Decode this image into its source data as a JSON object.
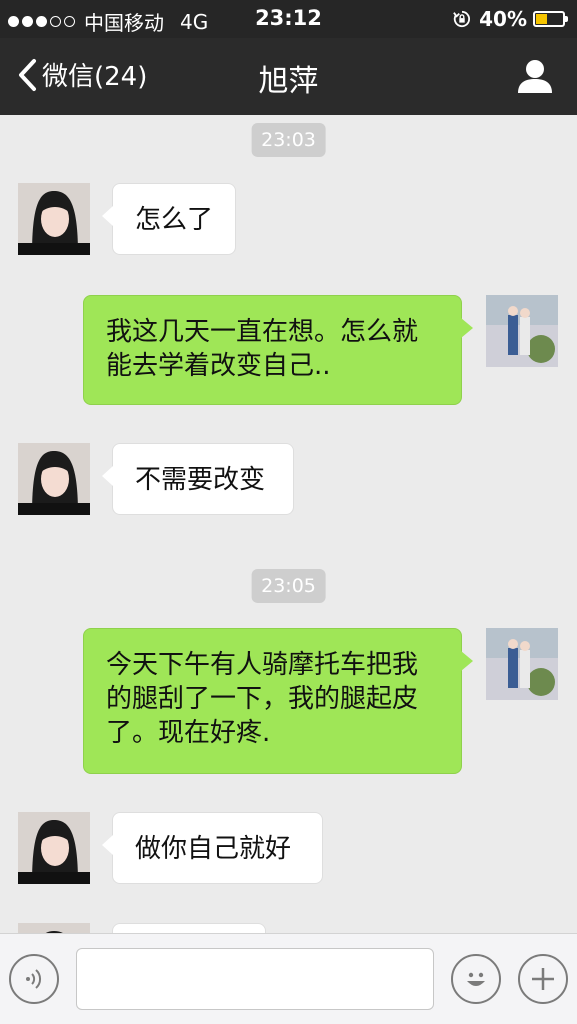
{
  "status_bar": {
    "carrier": "中国移动",
    "network": "4G",
    "time": "23:12",
    "battery_percent": "40%",
    "battery_level": 0.4,
    "signal_bars": 3,
    "signal_total": 5
  },
  "nav": {
    "back_label": "微信(24)",
    "title": "旭萍"
  },
  "messages": {
    "ts1": "23:03",
    "m1": "怎么了",
    "m2": "我这几天一直在想。怎么就能去学着改变自己..",
    "m3": "不需要改变",
    "ts2": "23:05",
    "m4": "今天下午有人骑摩托车把我的腿刮了一下，我的腿起皮了。现在好疼.",
    "m5": "做你自己就好"
  },
  "input": {
    "placeholder": ""
  },
  "colors": {
    "outgoing_bubble": "#9fe657",
    "incoming_bubble": "#ffffff",
    "chat_background": "#ebebeb",
    "nav_background": "#2b2b2b",
    "timestamp_background": "#cecece"
  },
  "icons": {
    "back": "chevron-left-icon",
    "profile": "person-icon",
    "voice": "voice-wave-icon",
    "emoji": "smiley-icon",
    "more": "plus-icon"
  }
}
